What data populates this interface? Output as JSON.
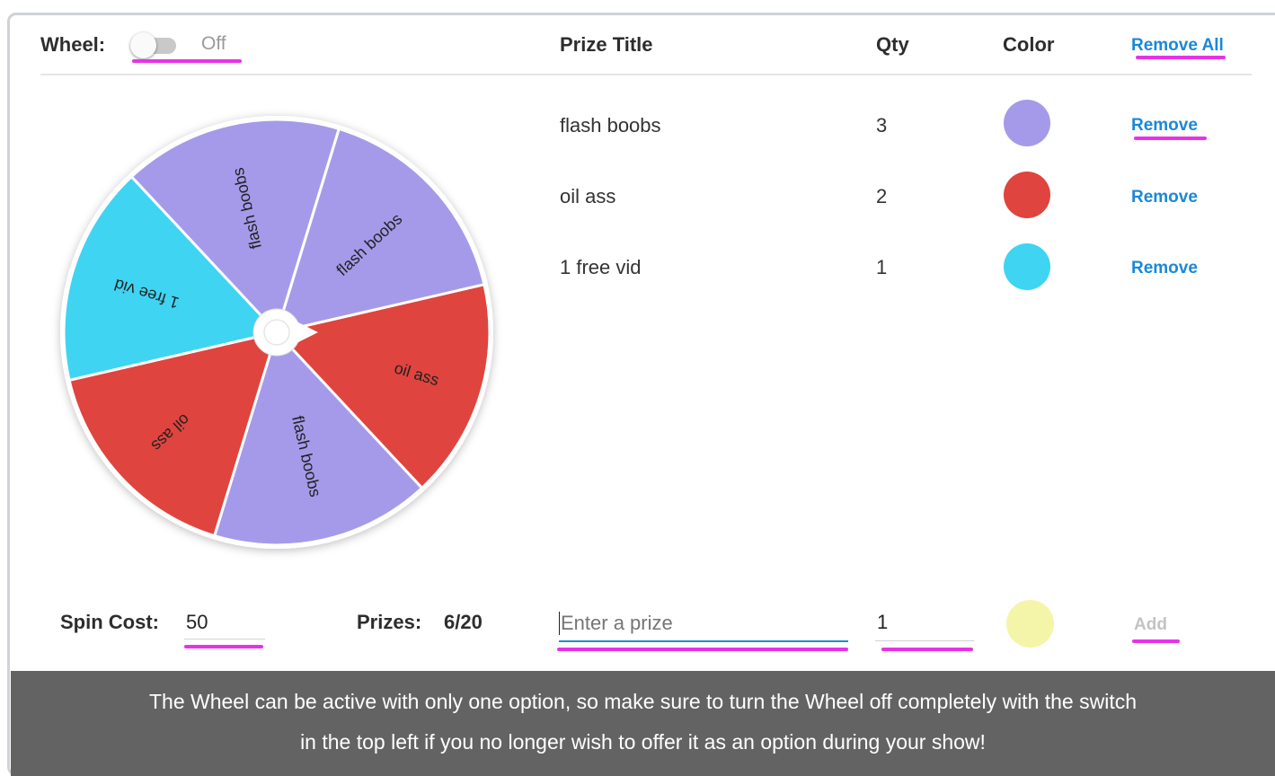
{
  "header": {
    "wheel_label": "Wheel:",
    "toggle_state": "Off",
    "col_prize_title": "Prize Title",
    "col_qty": "Qty",
    "col_color": "Color",
    "remove_all": "Remove All"
  },
  "prizes": [
    {
      "title": "flash boobs",
      "qty": "3",
      "color": "#a59aea",
      "action": "Remove"
    },
    {
      "title": "oil ass",
      "qty": "2",
      "color": "#e0443e",
      "action": "Remove"
    },
    {
      "title": "1 free vid",
      "qty": "1",
      "color": "#3fd4f2",
      "action": "Remove"
    }
  ],
  "wheel": {
    "slices": [
      {
        "label": "oil ass",
        "color": "#e0443e"
      },
      {
        "label": "flash boobs",
        "color": "#a59aea"
      },
      {
        "label": "oil ass",
        "color": "#e0443e"
      },
      {
        "label": "1 free vid",
        "color": "#3fd4f2"
      },
      {
        "label": "flash boobs",
        "color": "#a59aea"
      },
      {
        "label": "flash boobs",
        "color": "#a59aea"
      }
    ],
    "pointer_icon": "wheel-pointer-icon"
  },
  "footer_controls": {
    "spin_cost_label": "Spin Cost:",
    "spin_cost_value": "50",
    "prizes_label": "Prizes:",
    "prizes_count": "6/20",
    "prize_placeholder": "Enter a prize",
    "qty_value": "1",
    "new_color": "#f5f5aa",
    "add_label": "Add"
  },
  "note": {
    "line1": "The Wheel can be active with only one option, so make sure to turn the Wheel off completely with the switch",
    "line2": "in the top left if you no longer wish to offer it as an option during your show!"
  },
  "colors": {
    "accent_link": "#1a88d8",
    "highlight": "#e832e8",
    "footer_bg": "#636363"
  }
}
